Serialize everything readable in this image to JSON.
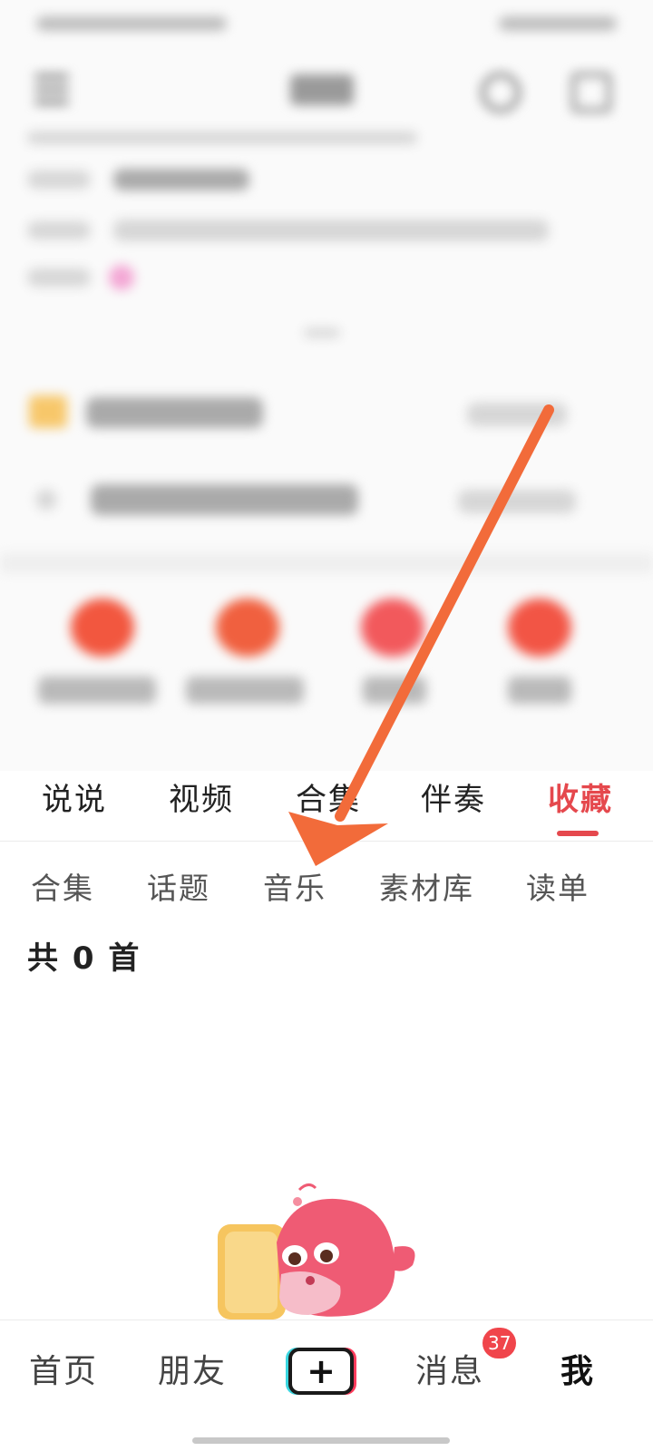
{
  "main_tabs": {
    "items": [
      "说说",
      "视频",
      "合集",
      "伴奏",
      "收藏"
    ],
    "active": "收藏"
  },
  "sub_tabs": {
    "items": [
      "合集",
      "话题",
      "音乐",
      "素材库",
      "读单"
    ]
  },
  "collection": {
    "count_label": "共 0 首"
  },
  "bottom_nav": {
    "home": "首页",
    "friends": "朋友",
    "add": "+",
    "messages": "消息",
    "messages_badge": "37",
    "me": "我"
  },
  "colors": {
    "accent": "#e5484d",
    "arrow": "#f26b3a",
    "badge": "#f0454b"
  },
  "icons": {
    "add": "plus-icon",
    "mascot": "mascot-illustration",
    "menu": "menu-icon",
    "search": "search-icon",
    "edit": "edit-icon"
  }
}
